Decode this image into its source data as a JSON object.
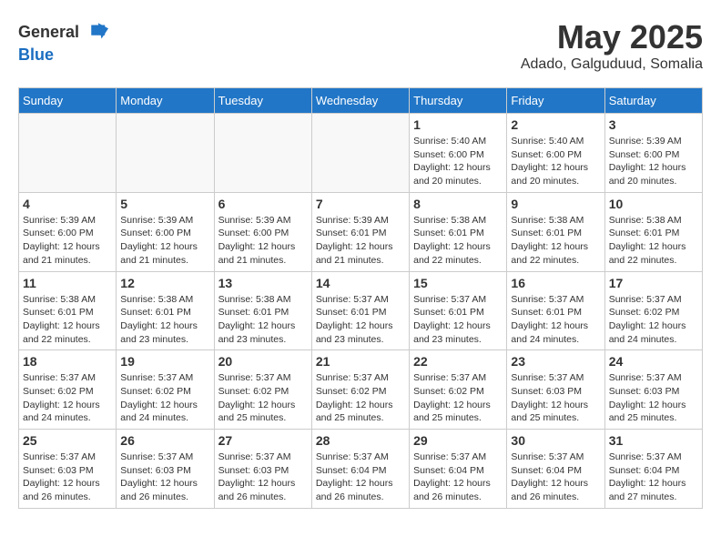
{
  "header": {
    "logo_general": "General",
    "logo_blue": "Blue",
    "month": "May 2025",
    "location": "Adado, Galguduud, Somalia"
  },
  "weekdays": [
    "Sunday",
    "Monday",
    "Tuesday",
    "Wednesday",
    "Thursday",
    "Friday",
    "Saturday"
  ],
  "weeks": [
    [
      {
        "day": "",
        "info": ""
      },
      {
        "day": "",
        "info": ""
      },
      {
        "day": "",
        "info": ""
      },
      {
        "day": "",
        "info": ""
      },
      {
        "day": "1",
        "info": "Sunrise: 5:40 AM\nSunset: 6:00 PM\nDaylight: 12 hours\nand 20 minutes."
      },
      {
        "day": "2",
        "info": "Sunrise: 5:40 AM\nSunset: 6:00 PM\nDaylight: 12 hours\nand 20 minutes."
      },
      {
        "day": "3",
        "info": "Sunrise: 5:39 AM\nSunset: 6:00 PM\nDaylight: 12 hours\nand 20 minutes."
      }
    ],
    [
      {
        "day": "4",
        "info": "Sunrise: 5:39 AM\nSunset: 6:00 PM\nDaylight: 12 hours\nand 21 minutes."
      },
      {
        "day": "5",
        "info": "Sunrise: 5:39 AM\nSunset: 6:00 PM\nDaylight: 12 hours\nand 21 minutes."
      },
      {
        "day": "6",
        "info": "Sunrise: 5:39 AM\nSunset: 6:00 PM\nDaylight: 12 hours\nand 21 minutes."
      },
      {
        "day": "7",
        "info": "Sunrise: 5:39 AM\nSunset: 6:01 PM\nDaylight: 12 hours\nand 21 minutes."
      },
      {
        "day": "8",
        "info": "Sunrise: 5:38 AM\nSunset: 6:01 PM\nDaylight: 12 hours\nand 22 minutes."
      },
      {
        "day": "9",
        "info": "Sunrise: 5:38 AM\nSunset: 6:01 PM\nDaylight: 12 hours\nand 22 minutes."
      },
      {
        "day": "10",
        "info": "Sunrise: 5:38 AM\nSunset: 6:01 PM\nDaylight: 12 hours\nand 22 minutes."
      }
    ],
    [
      {
        "day": "11",
        "info": "Sunrise: 5:38 AM\nSunset: 6:01 PM\nDaylight: 12 hours\nand 22 minutes."
      },
      {
        "day": "12",
        "info": "Sunrise: 5:38 AM\nSunset: 6:01 PM\nDaylight: 12 hours\nand 23 minutes."
      },
      {
        "day": "13",
        "info": "Sunrise: 5:38 AM\nSunset: 6:01 PM\nDaylight: 12 hours\nand 23 minutes."
      },
      {
        "day": "14",
        "info": "Sunrise: 5:37 AM\nSunset: 6:01 PM\nDaylight: 12 hours\nand 23 minutes."
      },
      {
        "day": "15",
        "info": "Sunrise: 5:37 AM\nSunset: 6:01 PM\nDaylight: 12 hours\nand 23 minutes."
      },
      {
        "day": "16",
        "info": "Sunrise: 5:37 AM\nSunset: 6:01 PM\nDaylight: 12 hours\nand 24 minutes."
      },
      {
        "day": "17",
        "info": "Sunrise: 5:37 AM\nSunset: 6:02 PM\nDaylight: 12 hours\nand 24 minutes."
      }
    ],
    [
      {
        "day": "18",
        "info": "Sunrise: 5:37 AM\nSunset: 6:02 PM\nDaylight: 12 hours\nand 24 minutes."
      },
      {
        "day": "19",
        "info": "Sunrise: 5:37 AM\nSunset: 6:02 PM\nDaylight: 12 hours\nand 24 minutes."
      },
      {
        "day": "20",
        "info": "Sunrise: 5:37 AM\nSunset: 6:02 PM\nDaylight: 12 hours\nand 25 minutes."
      },
      {
        "day": "21",
        "info": "Sunrise: 5:37 AM\nSunset: 6:02 PM\nDaylight: 12 hours\nand 25 minutes."
      },
      {
        "day": "22",
        "info": "Sunrise: 5:37 AM\nSunset: 6:02 PM\nDaylight: 12 hours\nand 25 minutes."
      },
      {
        "day": "23",
        "info": "Sunrise: 5:37 AM\nSunset: 6:03 PM\nDaylight: 12 hours\nand 25 minutes."
      },
      {
        "day": "24",
        "info": "Sunrise: 5:37 AM\nSunset: 6:03 PM\nDaylight: 12 hours\nand 25 minutes."
      }
    ],
    [
      {
        "day": "25",
        "info": "Sunrise: 5:37 AM\nSunset: 6:03 PM\nDaylight: 12 hours\nand 26 minutes."
      },
      {
        "day": "26",
        "info": "Sunrise: 5:37 AM\nSunset: 6:03 PM\nDaylight: 12 hours\nand 26 minutes."
      },
      {
        "day": "27",
        "info": "Sunrise: 5:37 AM\nSunset: 6:03 PM\nDaylight: 12 hours\nand 26 minutes."
      },
      {
        "day": "28",
        "info": "Sunrise: 5:37 AM\nSunset: 6:04 PM\nDaylight: 12 hours\nand 26 minutes."
      },
      {
        "day": "29",
        "info": "Sunrise: 5:37 AM\nSunset: 6:04 PM\nDaylight: 12 hours\nand 26 minutes."
      },
      {
        "day": "30",
        "info": "Sunrise: 5:37 AM\nSunset: 6:04 PM\nDaylight: 12 hours\nand 26 minutes."
      },
      {
        "day": "31",
        "info": "Sunrise: 5:37 AM\nSunset: 6:04 PM\nDaylight: 12 hours\nand 27 minutes."
      }
    ]
  ]
}
